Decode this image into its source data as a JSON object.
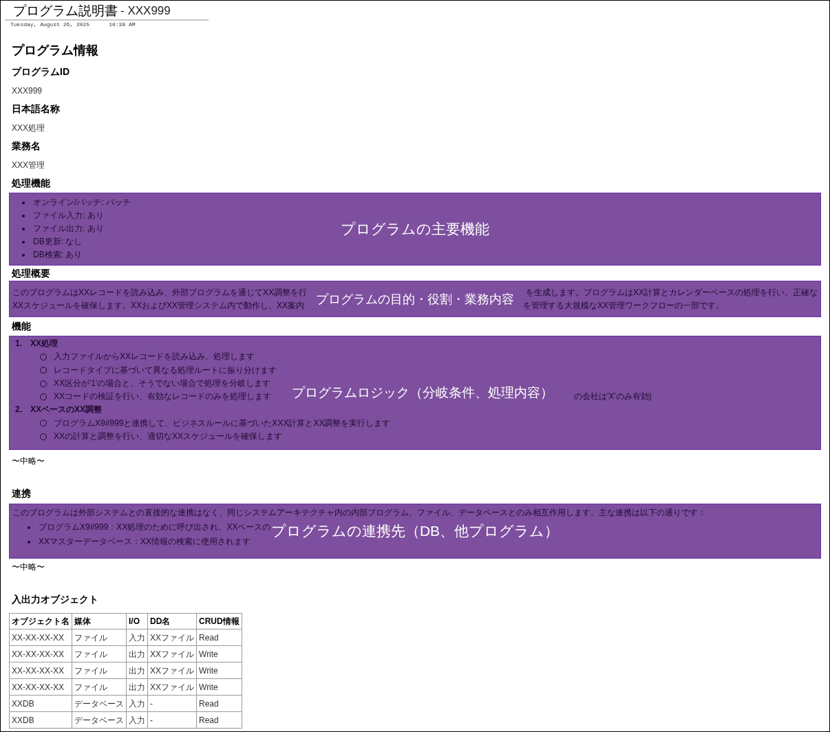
{
  "document": {
    "title": "プログラム説明書",
    "title_id": "- XXX999",
    "date": "Tuesday, August 26, 2025",
    "time": "10:38 AM"
  },
  "section_title": "プログラム情報",
  "fields": [
    {
      "label": "プログラムID",
      "value": "XXX999"
    },
    {
      "label": "日本語名称",
      "value": "XXX処理"
    },
    {
      "label": "業務名",
      "value": "XXX管理"
    }
  ],
  "processing_features": {
    "heading": "処理機能",
    "overlay_label": "プログラムの主要機能",
    "items": [
      "オンライン/バッチ: バッチ",
      "ファイル入力: あり",
      "ファイル出力: あり",
      "DB更新: なし",
      "DB検索: あり"
    ]
  },
  "summary": {
    "heading": "処理概要",
    "overlay_label": "プログラムの目的・役割・業務内容",
    "lines": [
      [
        "このプログラムはXXレコードを読み込み、外部プログラムを通じてXX調整を行",
        "を生成します。プログラムはXX計算とカレンダーベースの処理を行い、正確な"
      ],
      [
        "XXスケジュールを確保します。XXおよびXX管理システム内で動作し、XX案内",
        "を管理する大規模なXX管理ワークフローの一部です。"
      ]
    ]
  },
  "functions": {
    "heading": "機能",
    "overlay_label": "プログラムロジック（分岐条件、処理内容）",
    "groups": [
      {
        "number": "1.",
        "title": "XX処理",
        "items": [
          [
            "入力ファイルからXXレコードを読み込み、処理します"
          ],
          [
            "レコードタイプに基づいて異なる処理ルートに振り分けます"
          ],
          [
            "XX区分が'1'の場合と、そうでない場合で処理を分岐します"
          ],
          [
            "XXコードの検証を行い、有効なレコードのみを処理します",
            "の会社は'X'のみ有効)"
          ]
        ]
      },
      {
        "number": "2.",
        "title": "XXベースのXX調整",
        "items": [
          [
            "プログラムX9#999と連携して、ビジネスルールに基づいたXXX計算とXX調整を実行します"
          ],
          [
            "XXの計算と調整を行い、適切なXXスケジュールを確保します"
          ]
        ]
      }
    ]
  },
  "omitted_1": "〜中略〜",
  "integration": {
    "heading": "連携",
    "overlay_label": "プログラムの連携先（DB、他プログラム）",
    "intro": "このプログラムは外部システムとの直接的な連携はなく、同じシステムアーキテクチャ内の内部プログラム、ファイル、データベースとのみ相互作用します。主な連携は以下の通りです：",
    "items": [
      [
        "プログラムX9#999：XX処理のために呼び出され、XXベースの"
      ],
      [
        "XXマスターデータベース：XX情報の検索に使用されます"
      ]
    ]
  },
  "omitted_2": "〜中略〜",
  "io_objects": {
    "heading": "入出力オブジェクト",
    "columns": [
      "オブジェクト名",
      "媒体",
      "I/O",
      "DD名",
      "CRUD情報"
    ],
    "rows": [
      [
        "XX-XX-XX-XX",
        "ファイル",
        "入力",
        "XXファイル",
        "Read"
      ],
      [
        "XX-XX-XX-XX",
        "ファイル",
        "出力",
        "XXファイル",
        "Write"
      ],
      [
        "XX-XX-XX-XX",
        "ファイル",
        "出力",
        "XXファイル",
        "Write"
      ],
      [
        "XX-XX-XX-XX",
        "ファイル",
        "出力",
        "XXファイル",
        "Write"
      ],
      [
        "XXDB",
        "データベース",
        "入力",
        "-",
        "Read"
      ],
      [
        "XXDB",
        "データベース",
        "入力",
        "-",
        "Read"
      ]
    ]
  }
}
